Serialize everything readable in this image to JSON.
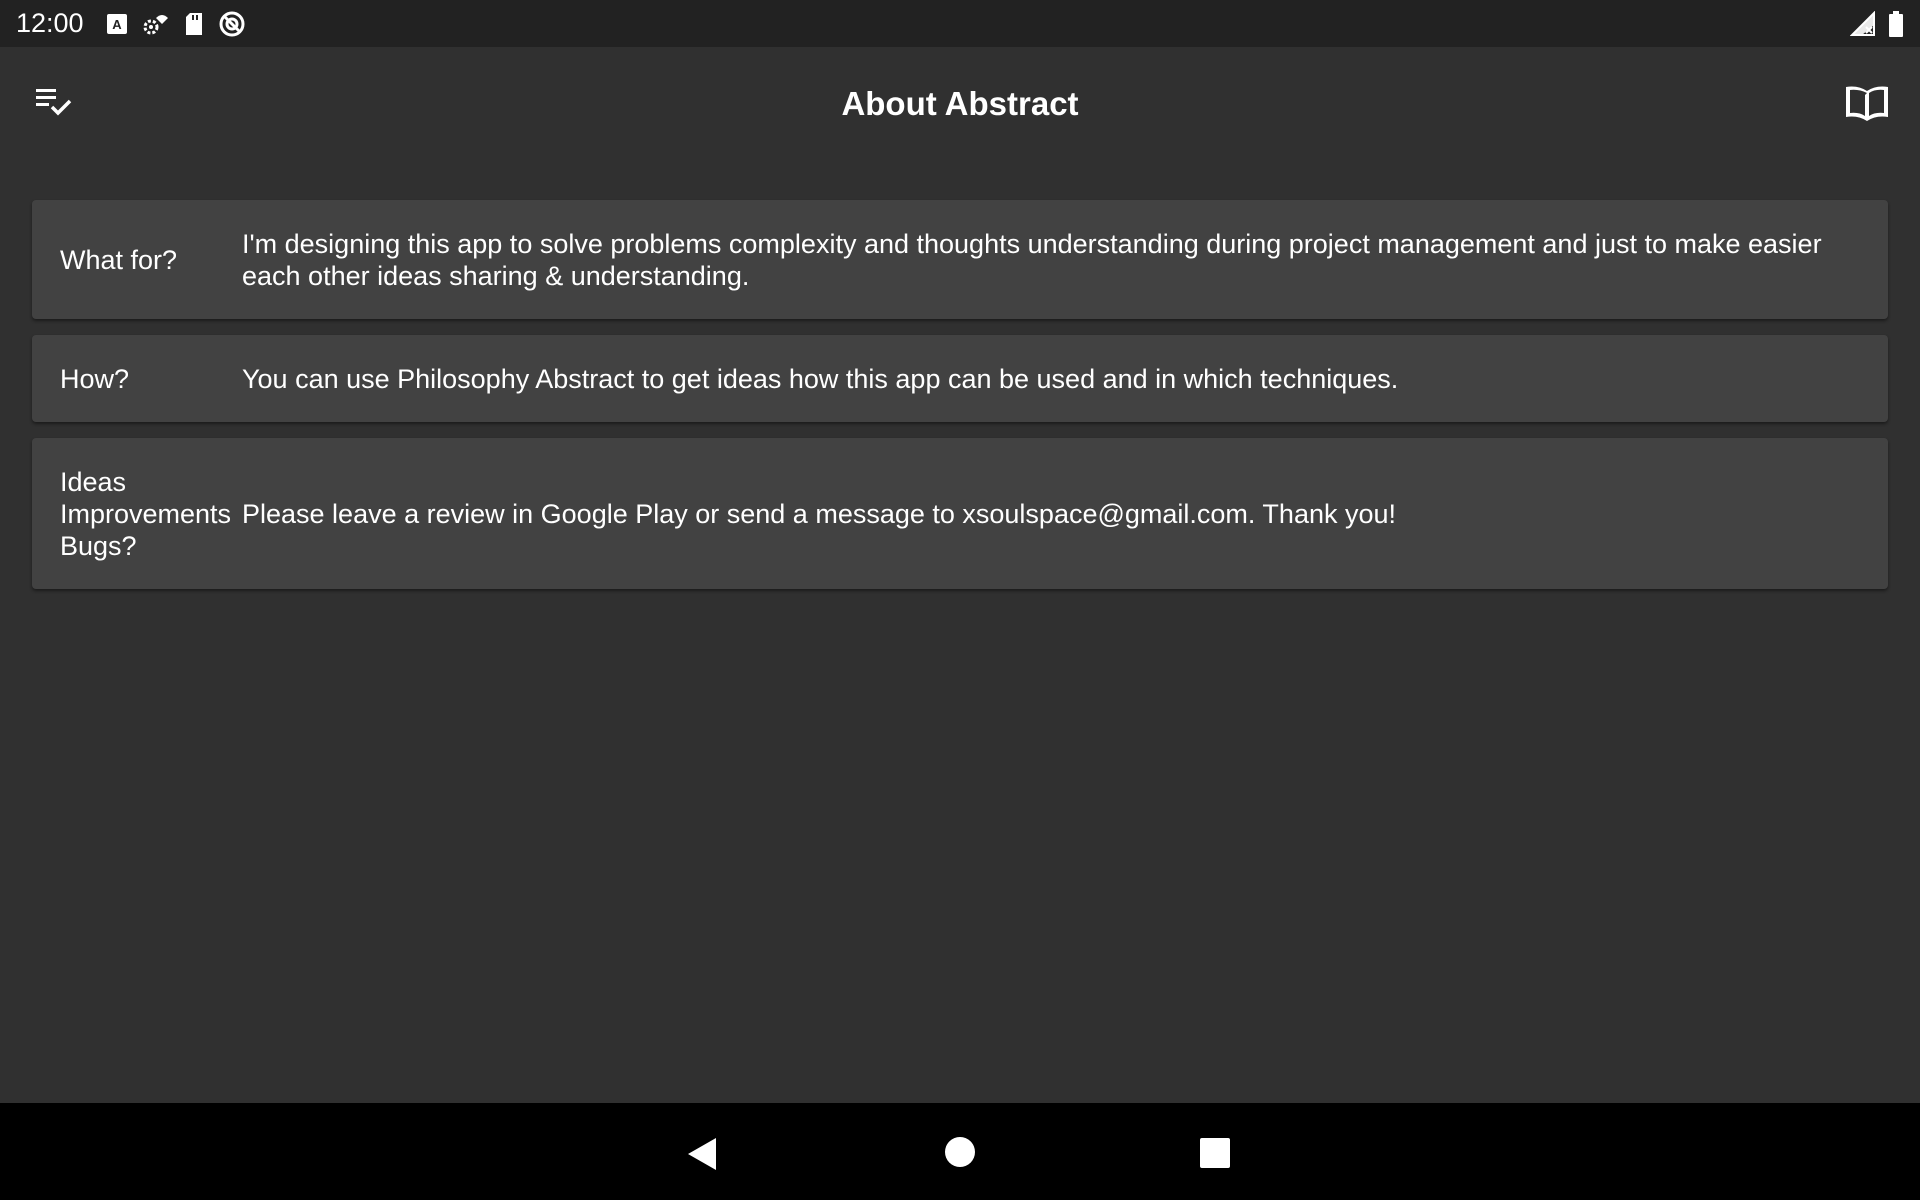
{
  "status_bar": {
    "time": "12:00",
    "icons": [
      "a-notification-icon",
      "settings-wifi-icon",
      "sd-card-icon",
      "sync-icon"
    ],
    "right_icons": [
      "signal-icon",
      "battery-icon"
    ]
  },
  "app_bar": {
    "title": "About Abstract",
    "left_icon": "checklist-icon",
    "right_icon": "book-icon"
  },
  "cards": [
    {
      "label": "What for?",
      "text": "I'm designing this app to solve problems complexity and thoughts understanding during project management and just to make easier each other ideas sharing & understanding."
    },
    {
      "label": "How?",
      "text": "You can use Philosophy Abstract to get ideas how this app can be used and in which techniques."
    },
    {
      "label": "Ideas Improvements Bugs?",
      "text": "Please leave a review in Google Play or send a message to xsoulspace@gmail.com. Thank you!"
    }
  ],
  "nav_bar": {
    "icons": [
      "back-icon",
      "home-icon",
      "recent-apps-icon"
    ]
  },
  "colors": {
    "background": "#303030",
    "card": "#424242",
    "status_bar": "#222222",
    "nav_bar": "#000000",
    "text": "#ffffff"
  }
}
